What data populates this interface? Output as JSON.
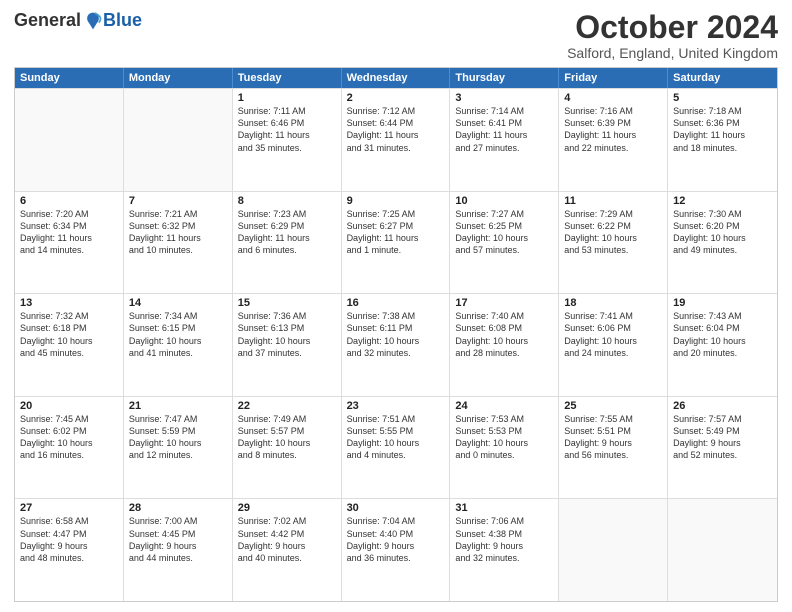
{
  "logo": {
    "general": "General",
    "blue": "Blue"
  },
  "header": {
    "month": "October 2024",
    "location": "Salford, England, United Kingdom"
  },
  "days": [
    "Sunday",
    "Monday",
    "Tuesday",
    "Wednesday",
    "Thursday",
    "Friday",
    "Saturday"
  ],
  "weeks": [
    [
      {
        "day": "",
        "lines": []
      },
      {
        "day": "",
        "lines": []
      },
      {
        "day": "1",
        "lines": [
          "Sunrise: 7:11 AM",
          "Sunset: 6:46 PM",
          "Daylight: 11 hours",
          "and 35 minutes."
        ]
      },
      {
        "day": "2",
        "lines": [
          "Sunrise: 7:12 AM",
          "Sunset: 6:44 PM",
          "Daylight: 11 hours",
          "and 31 minutes."
        ]
      },
      {
        "day": "3",
        "lines": [
          "Sunrise: 7:14 AM",
          "Sunset: 6:41 PM",
          "Daylight: 11 hours",
          "and 27 minutes."
        ]
      },
      {
        "day": "4",
        "lines": [
          "Sunrise: 7:16 AM",
          "Sunset: 6:39 PM",
          "Daylight: 11 hours",
          "and 22 minutes."
        ]
      },
      {
        "day": "5",
        "lines": [
          "Sunrise: 7:18 AM",
          "Sunset: 6:36 PM",
          "Daylight: 11 hours",
          "and 18 minutes."
        ]
      }
    ],
    [
      {
        "day": "6",
        "lines": [
          "Sunrise: 7:20 AM",
          "Sunset: 6:34 PM",
          "Daylight: 11 hours",
          "and 14 minutes."
        ]
      },
      {
        "day": "7",
        "lines": [
          "Sunrise: 7:21 AM",
          "Sunset: 6:32 PM",
          "Daylight: 11 hours",
          "and 10 minutes."
        ]
      },
      {
        "day": "8",
        "lines": [
          "Sunrise: 7:23 AM",
          "Sunset: 6:29 PM",
          "Daylight: 11 hours",
          "and 6 minutes."
        ]
      },
      {
        "day": "9",
        "lines": [
          "Sunrise: 7:25 AM",
          "Sunset: 6:27 PM",
          "Daylight: 11 hours",
          "and 1 minute."
        ]
      },
      {
        "day": "10",
        "lines": [
          "Sunrise: 7:27 AM",
          "Sunset: 6:25 PM",
          "Daylight: 10 hours",
          "and 57 minutes."
        ]
      },
      {
        "day": "11",
        "lines": [
          "Sunrise: 7:29 AM",
          "Sunset: 6:22 PM",
          "Daylight: 10 hours",
          "and 53 minutes."
        ]
      },
      {
        "day": "12",
        "lines": [
          "Sunrise: 7:30 AM",
          "Sunset: 6:20 PM",
          "Daylight: 10 hours",
          "and 49 minutes."
        ]
      }
    ],
    [
      {
        "day": "13",
        "lines": [
          "Sunrise: 7:32 AM",
          "Sunset: 6:18 PM",
          "Daylight: 10 hours",
          "and 45 minutes."
        ]
      },
      {
        "day": "14",
        "lines": [
          "Sunrise: 7:34 AM",
          "Sunset: 6:15 PM",
          "Daylight: 10 hours",
          "and 41 minutes."
        ]
      },
      {
        "day": "15",
        "lines": [
          "Sunrise: 7:36 AM",
          "Sunset: 6:13 PM",
          "Daylight: 10 hours",
          "and 37 minutes."
        ]
      },
      {
        "day": "16",
        "lines": [
          "Sunrise: 7:38 AM",
          "Sunset: 6:11 PM",
          "Daylight: 10 hours",
          "and 32 minutes."
        ]
      },
      {
        "day": "17",
        "lines": [
          "Sunrise: 7:40 AM",
          "Sunset: 6:08 PM",
          "Daylight: 10 hours",
          "and 28 minutes."
        ]
      },
      {
        "day": "18",
        "lines": [
          "Sunrise: 7:41 AM",
          "Sunset: 6:06 PM",
          "Daylight: 10 hours",
          "and 24 minutes."
        ]
      },
      {
        "day": "19",
        "lines": [
          "Sunrise: 7:43 AM",
          "Sunset: 6:04 PM",
          "Daylight: 10 hours",
          "and 20 minutes."
        ]
      }
    ],
    [
      {
        "day": "20",
        "lines": [
          "Sunrise: 7:45 AM",
          "Sunset: 6:02 PM",
          "Daylight: 10 hours",
          "and 16 minutes."
        ]
      },
      {
        "day": "21",
        "lines": [
          "Sunrise: 7:47 AM",
          "Sunset: 5:59 PM",
          "Daylight: 10 hours",
          "and 12 minutes."
        ]
      },
      {
        "day": "22",
        "lines": [
          "Sunrise: 7:49 AM",
          "Sunset: 5:57 PM",
          "Daylight: 10 hours",
          "and 8 minutes."
        ]
      },
      {
        "day": "23",
        "lines": [
          "Sunrise: 7:51 AM",
          "Sunset: 5:55 PM",
          "Daylight: 10 hours",
          "and 4 minutes."
        ]
      },
      {
        "day": "24",
        "lines": [
          "Sunrise: 7:53 AM",
          "Sunset: 5:53 PM",
          "Daylight: 10 hours",
          "and 0 minutes."
        ]
      },
      {
        "day": "25",
        "lines": [
          "Sunrise: 7:55 AM",
          "Sunset: 5:51 PM",
          "Daylight: 9 hours",
          "and 56 minutes."
        ]
      },
      {
        "day": "26",
        "lines": [
          "Sunrise: 7:57 AM",
          "Sunset: 5:49 PM",
          "Daylight: 9 hours",
          "and 52 minutes."
        ]
      }
    ],
    [
      {
        "day": "27",
        "lines": [
          "Sunrise: 6:58 AM",
          "Sunset: 4:47 PM",
          "Daylight: 9 hours",
          "and 48 minutes."
        ]
      },
      {
        "day": "28",
        "lines": [
          "Sunrise: 7:00 AM",
          "Sunset: 4:45 PM",
          "Daylight: 9 hours",
          "and 44 minutes."
        ]
      },
      {
        "day": "29",
        "lines": [
          "Sunrise: 7:02 AM",
          "Sunset: 4:42 PM",
          "Daylight: 9 hours",
          "and 40 minutes."
        ]
      },
      {
        "day": "30",
        "lines": [
          "Sunrise: 7:04 AM",
          "Sunset: 4:40 PM",
          "Daylight: 9 hours",
          "and 36 minutes."
        ]
      },
      {
        "day": "31",
        "lines": [
          "Sunrise: 7:06 AM",
          "Sunset: 4:38 PM",
          "Daylight: 9 hours",
          "and 32 minutes."
        ]
      },
      {
        "day": "",
        "lines": []
      },
      {
        "day": "",
        "lines": []
      }
    ]
  ]
}
